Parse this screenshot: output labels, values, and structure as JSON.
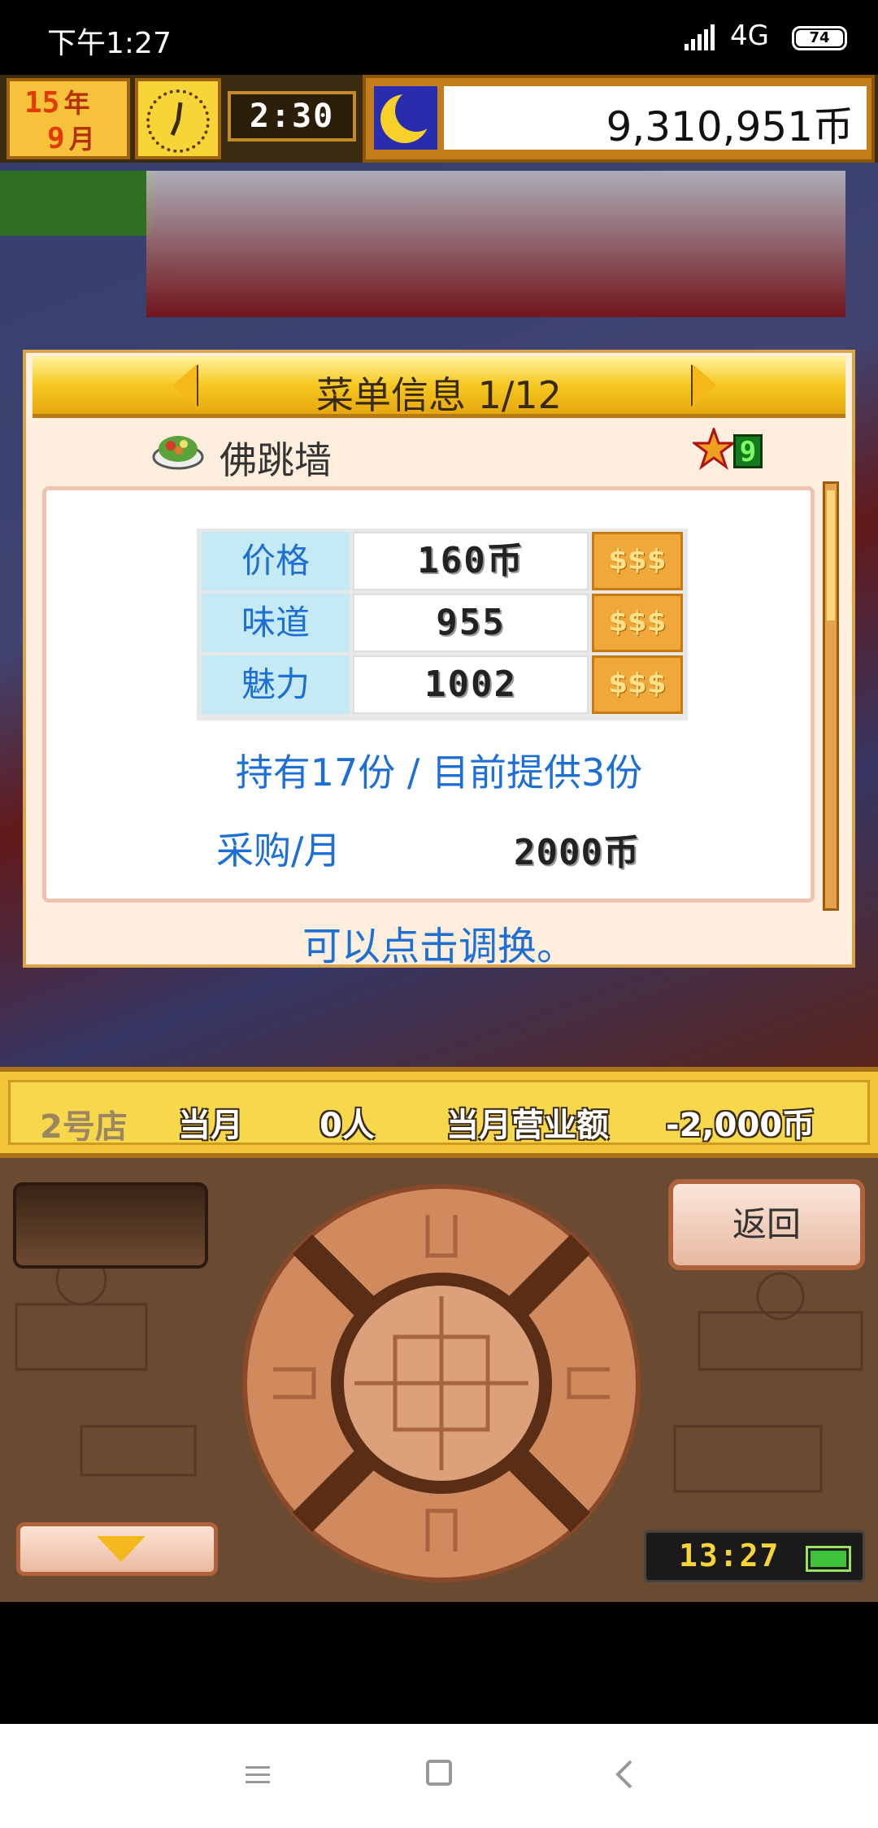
{
  "status_bar": {
    "time": "下午1:27",
    "network": "4G",
    "battery": "74"
  },
  "hud": {
    "year_num": "15",
    "year_unit": "年",
    "month_num": "9",
    "month_unit": "月",
    "game_time": "2:30",
    "money": "9,310,951币"
  },
  "dialog": {
    "title": "菜单信息 1/12",
    "dish_name": "佛跳墙",
    "rank": "9",
    "stats": [
      {
        "label": "价格",
        "value": "160币"
      },
      {
        "label": "味道",
        "value": "955"
      },
      {
        "label": "魅力",
        "value": "1002"
      }
    ],
    "coin_glyph": "$$$",
    "stock_text": "持有17份 / 目前提供3份",
    "purchase_label": "采购/月",
    "purchase_value": "2000币",
    "tap_hint": "可以点击调换。"
  },
  "store_bar": {
    "store_num": "2号店",
    "month_label": "当月",
    "customers": "0人",
    "revenue_label": "当月营业额",
    "revenue_value": "-2,000币"
  },
  "controls": {
    "back_label": "返回",
    "device_time": "13:27"
  },
  "colors": {
    "accent_blue": "#1e6fd4",
    "header_gold": "#f6c820",
    "panel_bg": "#fdeedd"
  }
}
